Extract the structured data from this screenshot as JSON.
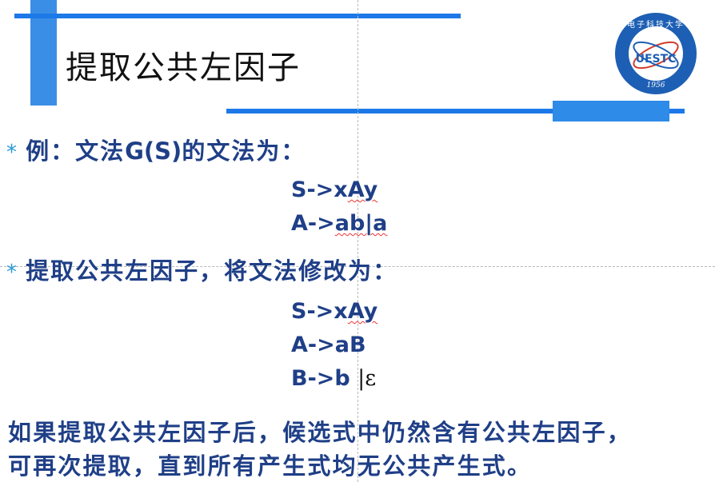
{
  "slide": {
    "title": "提取公共左因子",
    "bullet1": {
      "prefix": "例：文法",
      "g": "G(S)",
      "suffix": "的文法为："
    },
    "grammar1": {
      "line1_a": "S->x",
      "line1_b": "Ay",
      "line2_a": "A->",
      "line2_b": "ab|a"
    },
    "bullet2": "提取公共左因子，将文法修改为：",
    "grammar2": {
      "line1_a": "S->x",
      "line1_b": "Ay",
      "line2": "A->aB",
      "line3_a": "B->b ",
      "line3_bar": "|",
      "line3_eps": "ε"
    },
    "bottom_line1": "如果提取公共左因子后，候选式中仍然含有公共左因子，",
    "bottom_line2": "可再次提取，直到所有产生式均无公共产生式。",
    "bullet_char": "*"
  },
  "logo": {
    "center_text": "UESTC",
    "year": "1956",
    "top_text": "电子科技大学",
    "colors": {
      "ring": "#1d5fb4",
      "inner": "#ffffff",
      "accent": "#d23b2b"
    }
  },
  "colors": {
    "text": "#1f3f87",
    "bars": "#1d79e8",
    "bullet": "#2a9ad6"
  }
}
